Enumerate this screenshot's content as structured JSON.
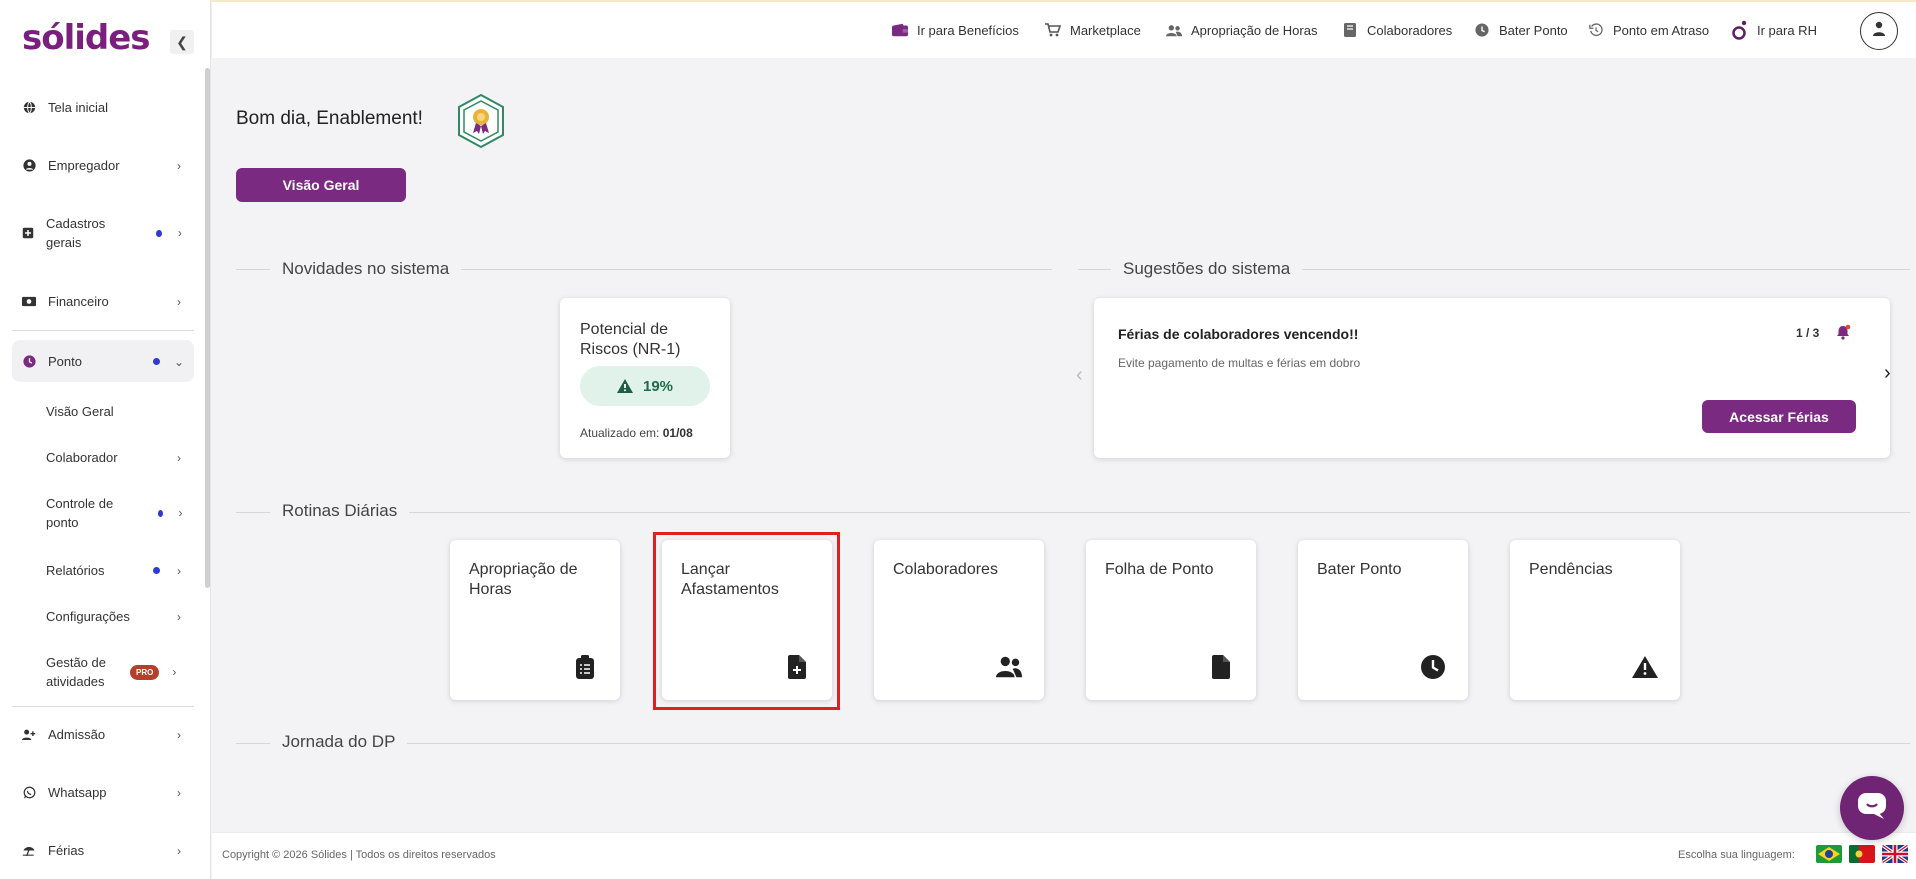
{
  "brand": {
    "logo": "sólides",
    "accent": "#7b2a82"
  },
  "sidebar": {
    "items": [
      {
        "label": "Tela inicial"
      },
      {
        "label": "Empregador"
      },
      {
        "label": "Cadastros gerais"
      },
      {
        "label": "Financeiro"
      },
      {
        "label": "Ponto"
      },
      {
        "label": "Admissão"
      },
      {
        "label": "Whatsapp"
      },
      {
        "label": "Férias"
      }
    ],
    "sub_items": [
      {
        "label": "Visão Geral"
      },
      {
        "label": "Colaborador"
      },
      {
        "label": "Controle de ponto"
      },
      {
        "label": "Relatórios"
      },
      {
        "label": "Configurações"
      },
      {
        "label": "Gestão de atividades",
        "badge": "PRO"
      }
    ]
  },
  "topbar": {
    "links": [
      {
        "label": "Ir para Benefícios"
      },
      {
        "label": "Marketplace"
      },
      {
        "label": "Apropriação de Horas"
      },
      {
        "label": "Colaboradores"
      },
      {
        "label": "Bater Ponto"
      },
      {
        "label": "Ponto em Atraso"
      },
      {
        "label": "Ir para RH"
      }
    ]
  },
  "main": {
    "greeting": "Bom dia, Enablement!",
    "overview_button": "Visão Geral",
    "news_title": "Novidades no sistema",
    "suggestions_title": "Sugestões do sistema",
    "risk_card": {
      "title": "Potencial de Riscos (NR-1)",
      "value": "19%",
      "updated_label": "Atualizado em:",
      "updated_date": "01/08"
    },
    "suggestion": {
      "title": "Férias de colaboradores vencendo!!",
      "description": "Evite pagamento de multas e férias em dobro",
      "counter": "1 / 3",
      "button": "Acessar Férias"
    },
    "routines_title": "Rotinas Diárias",
    "routines": [
      {
        "label": "Apropriação de Horas"
      },
      {
        "label": "Lançar Afastamentos"
      },
      {
        "label": "Colaboradores"
      },
      {
        "label": "Folha de Ponto"
      },
      {
        "label": "Bater Ponto"
      },
      {
        "label": "Pendências"
      }
    ],
    "journey_title": "Jornada do DP"
  },
  "footer": {
    "copyright": "Copyright © 2026 Sólides | Todos os direitos reservados",
    "language_label": "Escolha sua linguagem:"
  }
}
